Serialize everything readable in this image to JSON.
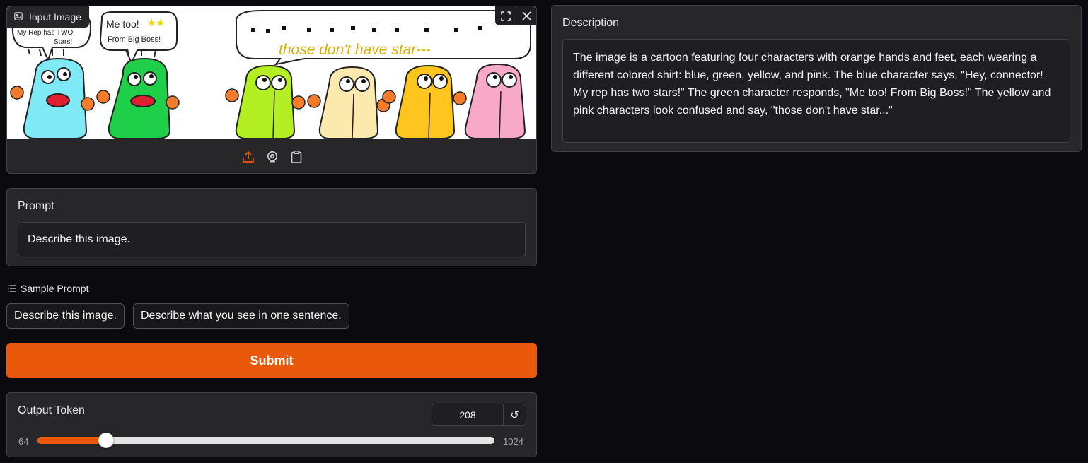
{
  "image_panel": {
    "label": "Input Image",
    "cartoon": {
      "bubble1": [
        "My Rep has TWO",
        "Stars!"
      ],
      "bubble2": [
        "Me too!",
        "From Big Boss!"
      ],
      "bubble3": "those don't have star---"
    },
    "icons": [
      "image-icon",
      "fullscreen-icon",
      "close-icon",
      "upload-icon",
      "webcam-icon",
      "clipboard-icon"
    ]
  },
  "prompt": {
    "label": "Prompt",
    "value": "Describe this image."
  },
  "samples": {
    "header": "Sample Prompt",
    "items": [
      "Describe this image.",
      "Describe what you see in one sentence."
    ]
  },
  "submit_label": "Submit",
  "output_token": {
    "label": "Output Token",
    "value": "208",
    "min": "64",
    "max": "1024",
    "fraction": 0.15
  },
  "description": {
    "label": "Description",
    "text": "The image is a cartoon featuring four characters with orange hands and feet, each wearing a different colored shirt: blue, green, yellow, and pink. The blue character says, \"Hey, connector! My rep has two stars!\" The green character responds, \"Me too! From Big Boss!\" The yellow and pink characters look confused and say, \"those don't have star...\""
  },
  "colors": {
    "accent": "#ea580c",
    "panel": "#27272a",
    "background": "#0b0b0f",
    "char_blue": "#7fe9f5",
    "char_green": "#1fcf4a",
    "char_lime": "#b3ef22",
    "char_cream": "#fbe9ae",
    "char_yellow": "#fec51f",
    "char_pink": "#f8a9c8",
    "char_limbs": "#f47b2b"
  }
}
